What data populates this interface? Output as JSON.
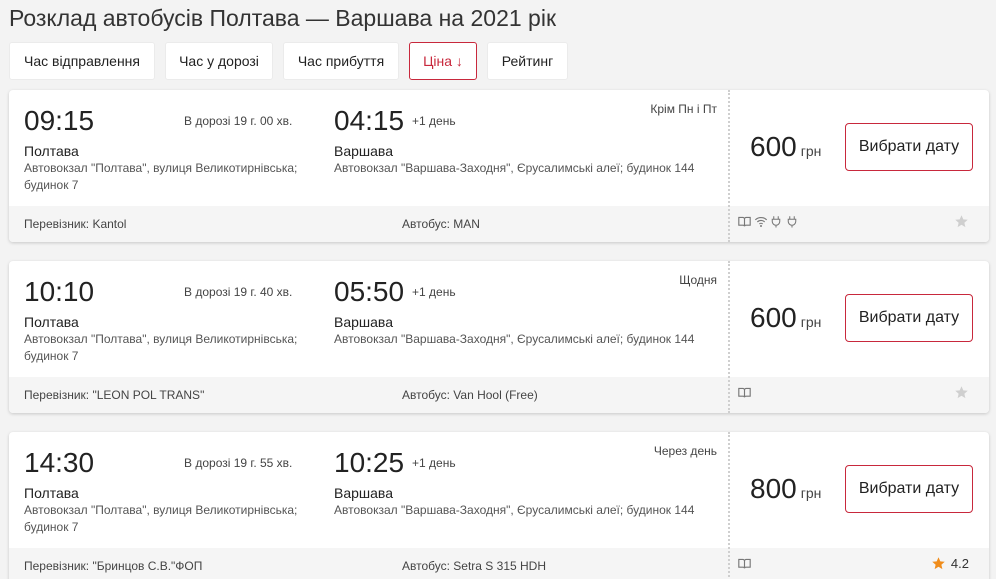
{
  "page": {
    "title": "Розклад автобусів Полтава — Варшава на 2021 рік"
  },
  "sort": {
    "options": [
      "Час відправлення",
      "Час у дорозі",
      "Час прибуття",
      "Ціна ↓",
      "Рейтинг"
    ],
    "active": "Ціна ↓"
  },
  "trips": [
    {
      "departure_time": "09:15",
      "duration": "В дорозі 19 г. 00 хв.",
      "arrival_time": "04:15",
      "plus_day": "+1 день",
      "schedule": "Крім Пн і Пт",
      "departure_city": "Полтава",
      "departure_address": "Автовокзал \"Полтава\", вулиця Великотирнівська; будинок 7",
      "arrival_city": "Варшава",
      "arrival_address": "Автовокзал \"Варшава-Заходня\", Єрусалимські алеї; будинок 144",
      "price": "600",
      "currency": "грн",
      "button": "Вибрати дату",
      "carrier": "Перевізник: Kantol",
      "bus": "Автобус: MAN",
      "amenities": [
        "book-icon",
        "wifi-icon",
        "socket-icon",
        "socket-icon"
      ],
      "rating": ""
    },
    {
      "departure_time": "10:10",
      "duration": "В дорозі 19 г. 40 хв.",
      "arrival_time": "05:50",
      "plus_day": "+1 день",
      "schedule": "Щодня",
      "departure_city": "Полтава",
      "departure_address": "Автовокзал \"Полтава\", вулиця Великотирнівська; будинок 7",
      "arrival_city": "Варшава",
      "arrival_address": "Автовокзал \"Варшава-Заходня\", Єрусалимські алеї; будинок 144",
      "price": "600",
      "currency": "грн",
      "button": "Вибрати дату",
      "carrier": "Перевізник: \"LEON POL TRANS\"",
      "bus": "Автобус: Van Hool (Free)",
      "amenities": [
        "book-icon"
      ],
      "rating": ""
    },
    {
      "departure_time": "14:30",
      "duration": "В дорозі 19 г. 55 хв.",
      "arrival_time": "10:25",
      "plus_day": "+1 день",
      "schedule": "Через день",
      "departure_city": "Полтава",
      "departure_address": "Автовокзал \"Полтава\", вулиця Великотирнівська; будинок 7",
      "arrival_city": "Варшава",
      "arrival_address": "Автовокзал \"Варшава-Заходня\", Єрусалимські алеї; будинок 144",
      "price": "800",
      "currency": "грн",
      "button": "Вибрати дату",
      "carrier": "Перевізник: \"Бринцов С.В.\"ФОП",
      "bus": "Автобус: Setra S 315 HDH",
      "amenities": [
        "book-icon"
      ],
      "rating": "4.2"
    }
  ],
  "colors": {
    "accent": "#c8283c",
    "star_active": "#f08c1a",
    "star_inactive": "#cfcfcf"
  }
}
